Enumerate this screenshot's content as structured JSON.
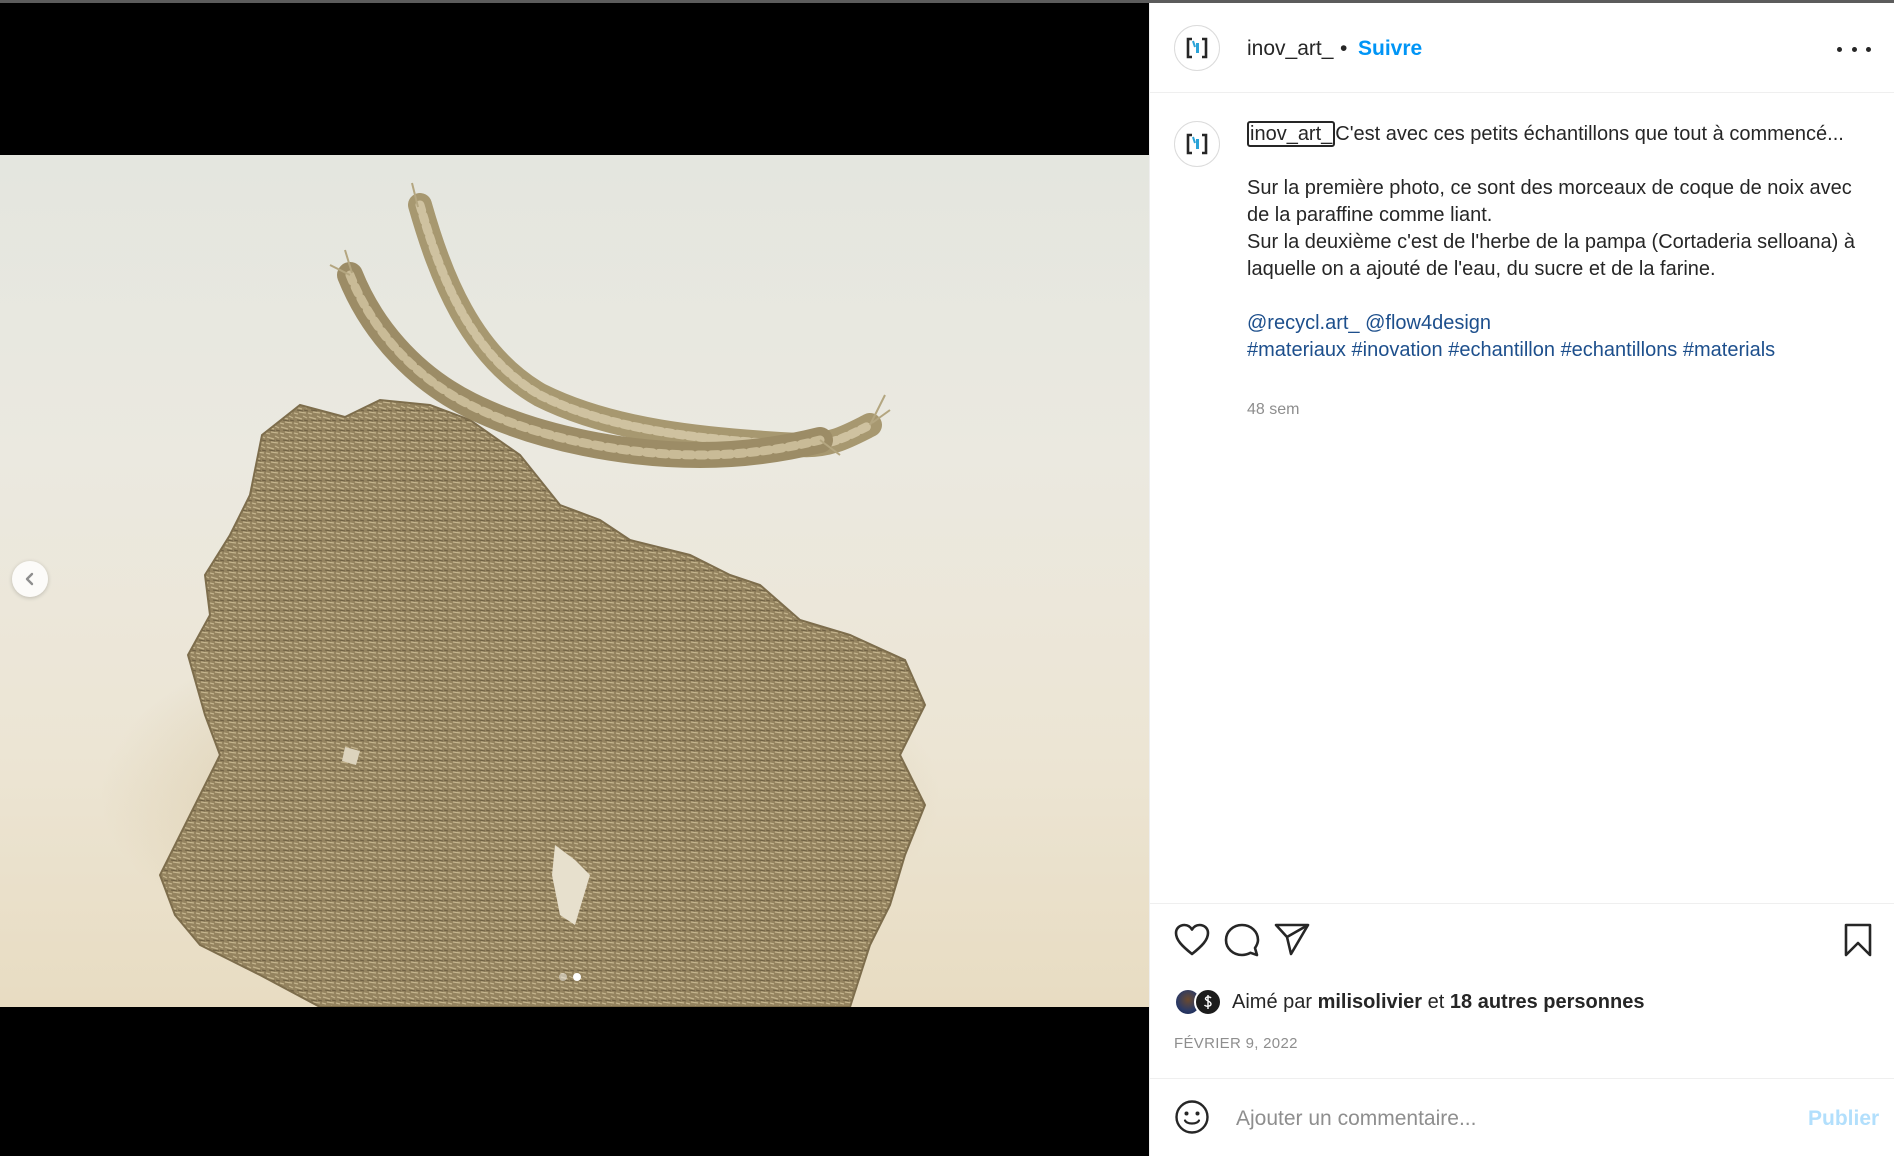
{
  "post": {
    "username": "inov_art_",
    "separator": "•",
    "follow_label": "Suivre",
    "caption": {
      "username": "inov_art_",
      "line1": "C'est avec ces petits échantillons que tout à commencé...",
      "para2_line1": "Sur la première photo, ce sont des morceaux de coque de noix avec de la paraffine comme liant.",
      "para2_line2": "Sur la deuxième c'est de l'herbe de la pampa (Cortaderia selloana) à laquelle on a ajouté de l'eau, du sucre et de la farine.",
      "mentions": [
        "@recycl.art_",
        "@flow4design"
      ],
      "hashtags": [
        "#materiaux",
        "#inovation",
        "#echantillon",
        "#echantillons",
        "#materials"
      ]
    },
    "time_ago": "48 sem",
    "likes": {
      "prefix": "Aimé par",
      "user": "milisolivier",
      "connector": "et",
      "others": "18 autres personnes"
    },
    "date": "FÉVRIER 9, 2022"
  },
  "carousel": {
    "slide_count": 2,
    "active_index": 1
  },
  "comment": {
    "placeholder": "Ajouter un commentaire...",
    "publish_label": "Publier"
  },
  "icons": {
    "avatar": "inov-art-logo-icon",
    "prev": "chevron-left-icon",
    "like": "heart-icon",
    "comment": "comment-bubble-icon",
    "share": "paper-plane-icon",
    "save": "bookmark-icon",
    "emoji": "smiley-icon",
    "more": "more-dots-icon"
  },
  "colors": {
    "link": "#1d4f8c",
    "follow": "#0095f6",
    "publish_disabled": "#b2dffc",
    "muted": "#8e8e8e"
  }
}
